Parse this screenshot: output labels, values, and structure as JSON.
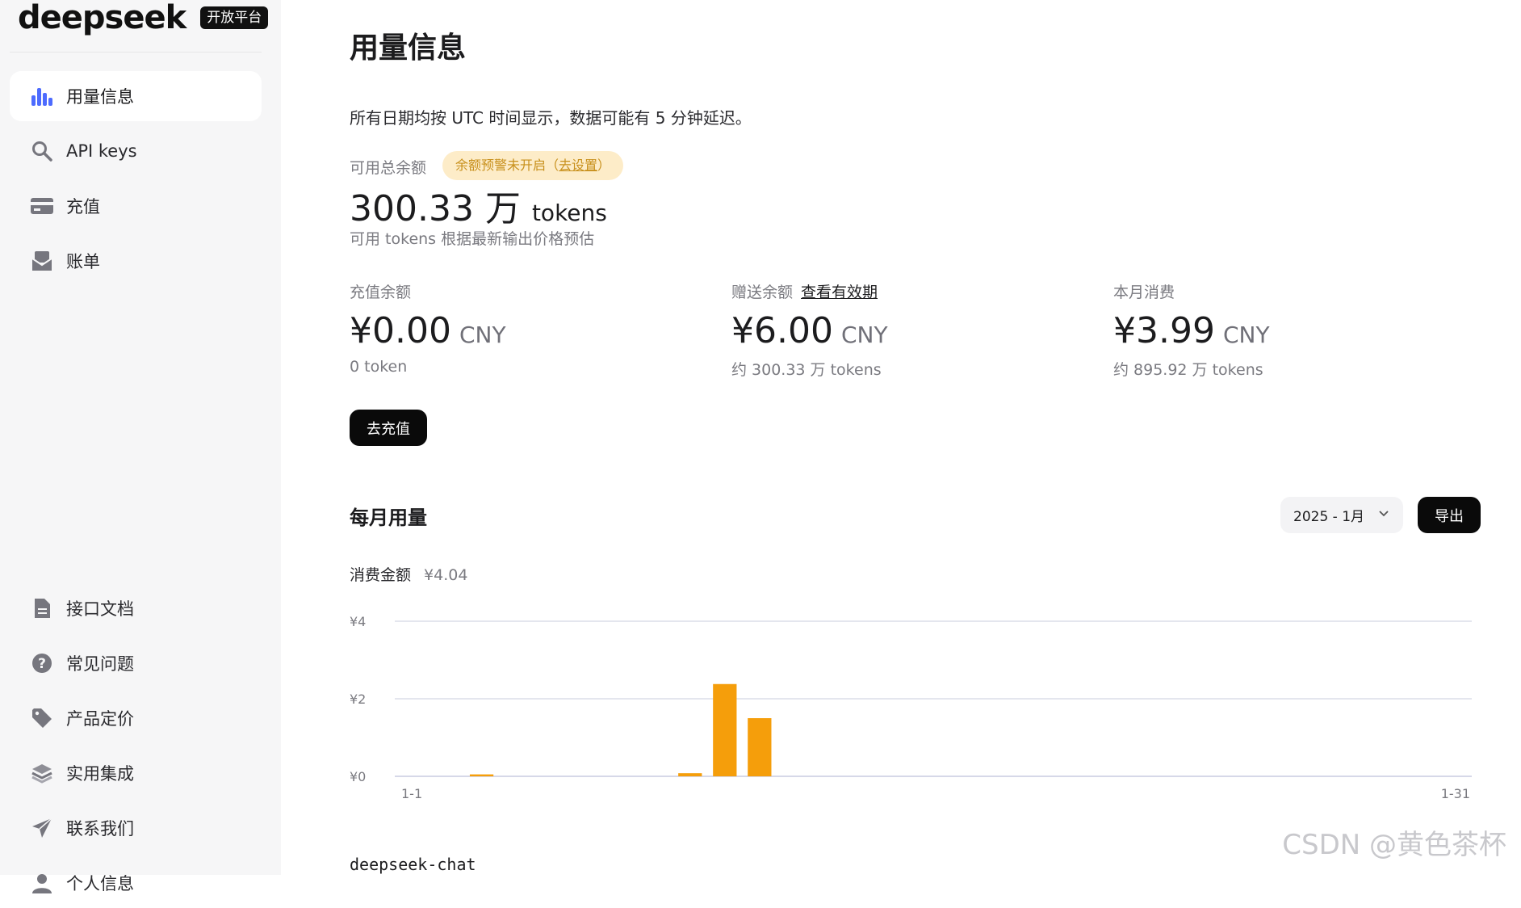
{
  "brand": {
    "name": "deepseek",
    "badge": "开放平台"
  },
  "sidebar": {
    "top_items": [
      {
        "label": "用量信息",
        "icon": "bar-chart-icon",
        "active": true
      },
      {
        "label": "API keys",
        "icon": "search-key-icon"
      },
      {
        "label": "充值",
        "icon": "credit-card-icon"
      },
      {
        "label": "账单",
        "icon": "envelope-icon"
      }
    ],
    "bottom_items": [
      {
        "label": "接口文档",
        "icon": "document-icon"
      },
      {
        "label": "常见问题",
        "icon": "question-icon"
      },
      {
        "label": "产品定价",
        "icon": "tag-icon"
      },
      {
        "label": "实用集成",
        "icon": "layers-icon"
      },
      {
        "label": "联系我们",
        "icon": "paper-plane-icon"
      },
      {
        "label": "个人信息",
        "icon": "user-icon"
      }
    ]
  },
  "page": {
    "title": "用量信息",
    "description": "所有日期均按 UTC 时间显示，数据可能有 5 分钟延迟。"
  },
  "balance": {
    "label": "可用总余额",
    "alert_text": "余额预警未开启（",
    "alert_link": "去设置",
    "alert_close": "）",
    "amount": "300.33 万",
    "unit": "tokens",
    "note": "可用 tokens 根据最新输出价格预估"
  },
  "cards": [
    {
      "label": "充值余额",
      "amount": "¥0.00",
      "currency": "CNY",
      "sub": "0 token"
    },
    {
      "label": "赠送余额",
      "link": "查看有效期",
      "amount": "¥6.00",
      "currency": "CNY",
      "sub": "约 300.33 万 tokens"
    },
    {
      "label": "本月消费",
      "amount": "¥3.99",
      "currency": "CNY",
      "sub": "约 895.92 万 tokens"
    }
  ],
  "recharge_button": "去充值",
  "monthly": {
    "title": "每月用量",
    "month_select": "2025 - 1月",
    "export_button": "导出",
    "spend_label": "消费金额",
    "spend_value": "¥4.04"
  },
  "colors": {
    "bar": "#f59e0b",
    "accent": "#4d6bfe"
  },
  "chart_data": {
    "type": "bar",
    "x_start_label": "1-1",
    "x_end_label": "1-31",
    "y_tick_labels": [
      "¥4",
      "¥2",
      "¥0"
    ],
    "ylim": [
      0,
      4
    ],
    "grid": true,
    "categories": [
      "1-1",
      "1-2",
      "1-3",
      "1-4",
      "1-5",
      "1-6",
      "1-7",
      "1-8",
      "1-9",
      "1-10",
      "1-11",
      "1-12",
      "1-13",
      "1-14",
      "1-15",
      "1-16",
      "1-17",
      "1-18",
      "1-19",
      "1-20",
      "1-21",
      "1-22",
      "1-23",
      "1-24",
      "1-25",
      "1-26",
      "1-27",
      "1-28",
      "1-29",
      "1-30",
      "1-31"
    ],
    "values": [
      0,
      0,
      0.05,
      0,
      0,
      0,
      0,
      0,
      0.08,
      2.38,
      1.5,
      0,
      0,
      0,
      0,
      0,
      0,
      0,
      0,
      0,
      0,
      0,
      0,
      0,
      0,
      0,
      0,
      0,
      0,
      0,
      0
    ]
  },
  "model_section_title": "deepseek-chat",
  "watermark": "CSDN @黄色茶杯"
}
